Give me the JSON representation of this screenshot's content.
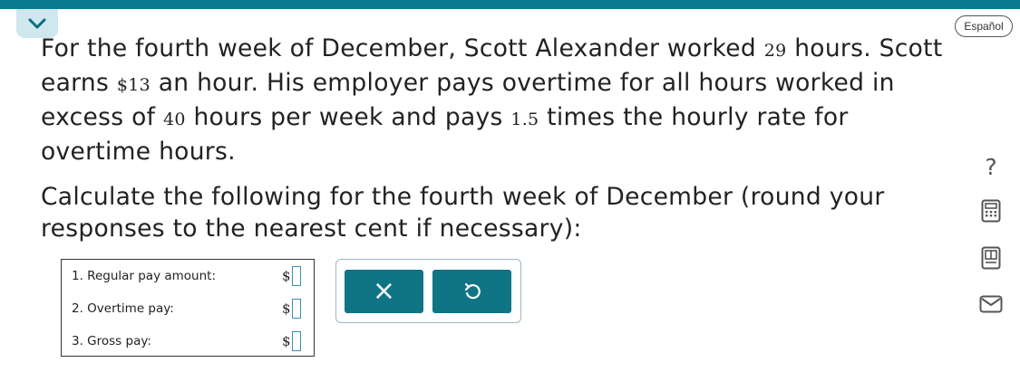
{
  "header": {
    "language_button": "Español"
  },
  "problem": {
    "p1_a": "For the fourth week of December, Scott Alexander worked ",
    "hours_worked": "29",
    "p1_b": " hours. Scott earns ",
    "hourly_rate": "$13",
    "p1_c": " an hour. His employer pays overtime for all hours worked in excess of ",
    "overtime_threshold": "40",
    "p1_d": " hours per week and pays ",
    "overtime_multiplier": "1.5",
    "p1_e": " times the hourly rate for overtime hours.",
    "p2": "Calculate the following for the fourth week of December (round your responses to the nearest cent if necessary):"
  },
  "answers": {
    "rows": [
      {
        "label": "1. Regular pay amount:",
        "currency": "$",
        "value": ""
      },
      {
        "label": "2. Overtime pay:",
        "currency": "$",
        "value": ""
      },
      {
        "label": "3. Gross pay:",
        "currency": "$",
        "value": ""
      }
    ]
  },
  "actions": {
    "clear_icon": "×",
    "undo_icon": "undo-icon"
  },
  "sidebar": {
    "help_label": "?",
    "icons": [
      "question-icon",
      "calculator-icon",
      "textbook-icon",
      "mail-icon"
    ]
  },
  "colors": {
    "accent": "#0b7a8f",
    "action_button": "#0f7585",
    "tab_bg": "#cfe7ef"
  }
}
